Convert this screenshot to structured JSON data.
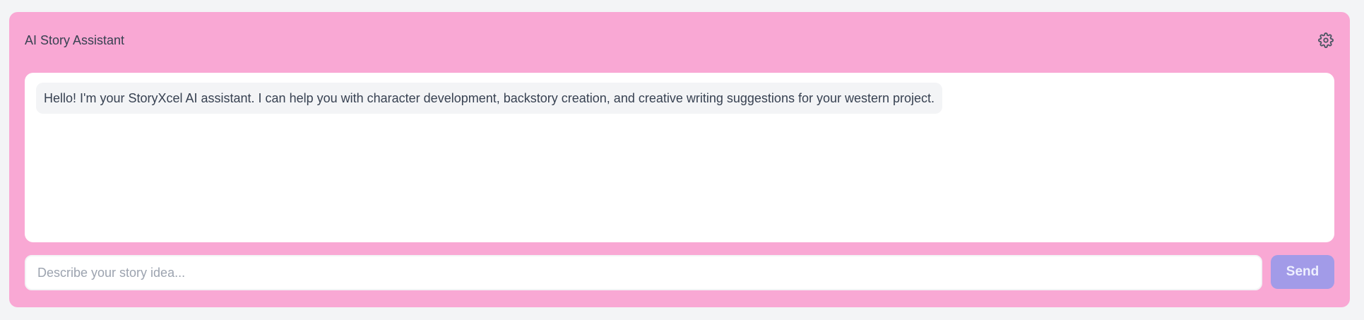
{
  "header": {
    "title": "AI Story Assistant",
    "settings_icon": "gear-icon"
  },
  "messages": [
    {
      "text": "Hello! I'm your StoryXcel AI assistant. I can help you with character development, backstory creation, and creative writing suggestions for your western project."
    }
  ],
  "composer": {
    "placeholder": "Describe your story idea...",
    "value": "",
    "send_label": "Send"
  },
  "colors": {
    "panel_bg": "#f9a8d4",
    "page_bg": "#f3f4f6",
    "send_bg": "#a29be8",
    "text": "#374151"
  }
}
